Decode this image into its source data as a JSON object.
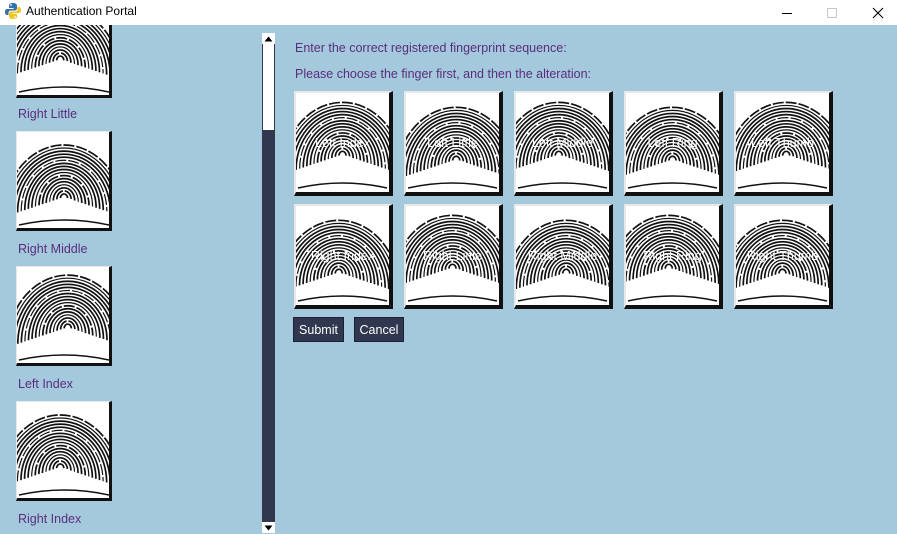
{
  "window": {
    "title": "Authentication Portal",
    "icons": {
      "app": "python-icon",
      "minimize": "minimize-icon",
      "maximize": "maximize-icon",
      "close": "close-icon"
    }
  },
  "sidebar": {
    "items": [
      {
        "label": "Right Little"
      },
      {
        "label": "Right Middle"
      },
      {
        "label": "Left Index"
      },
      {
        "label": "Right Index"
      }
    ]
  },
  "main": {
    "prompt_sequence": "Enter the correct registered fingerprint sequence:",
    "prompt_choose": "Please choose the finger first, and then the alteration:",
    "fingers": [
      {
        "label": "Left Index"
      },
      {
        "label": "Left Little"
      },
      {
        "label": "Left Middle"
      },
      {
        "label": "Left Ring"
      },
      {
        "label": "Left Thumb"
      },
      {
        "label": "Right Index"
      },
      {
        "label": "Right Little"
      },
      {
        "label": "Right Middle"
      },
      {
        "label": "Right Ring"
      },
      {
        "label": "Right Thumb"
      }
    ],
    "submit_label": "Submit",
    "cancel_label": "Cancel"
  },
  "colors": {
    "background": "#a4c9dd",
    "text_accent": "#5a2d7c",
    "button_dark": "#30374f"
  }
}
